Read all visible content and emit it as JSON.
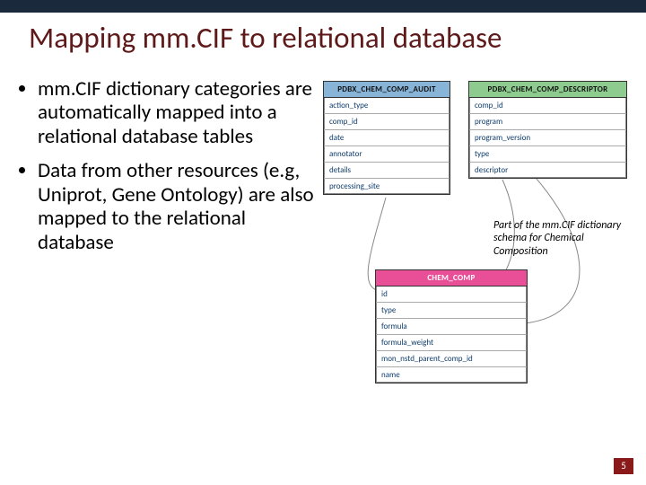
{
  "title": "Mapping mm.CIF to relational database",
  "bullets": [
    "mm.CIF dictionary categories are automatically mapped into a relational database tables",
    "Data from other resources (e.g, Uniprot, Gene Ontology) are also mapped to the relational database"
  ],
  "caption": "Part of the mm.CIF dictionary schema for Chemical Composition",
  "tables": {
    "audit": {
      "header": "PDBX_CHEM_COMP_AUDIT",
      "rows": [
        "action_type",
        "comp_id",
        "date",
        "annotator",
        "details",
        "processing_site"
      ]
    },
    "descriptor": {
      "header": "PDBX_CHEM_COMP_DESCRIPTOR",
      "rows": [
        "comp_id",
        "program",
        "program_version",
        "type",
        "descriptor"
      ]
    },
    "chem": {
      "header": "CHEM_COMP",
      "rows": [
        "id",
        "type",
        "formula",
        "formula_weight",
        "mon_nstd_parent_comp_id",
        "name"
      ]
    }
  },
  "page_number": "5"
}
